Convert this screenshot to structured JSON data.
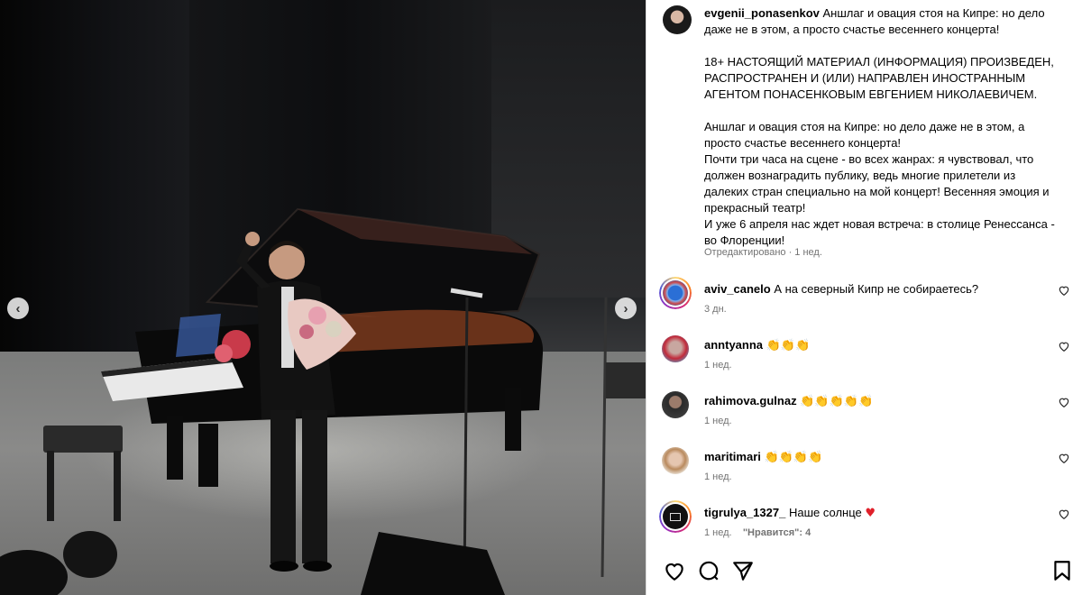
{
  "post": {
    "author": "evgenii_ponasenkov",
    "caption_first": "Аншлаг и овация стоя на Кипре: но дело даже не в этом, а просто счастье весеннего концерта!",
    "caption_body": "18+ НАСТОЯЩИЙ МАТЕРИАЛ (ИНФОРМАЦИЯ) ПРОИЗВЕДЕН, РАСПРОСТРАНЕН И (ИЛИ) НАПРАВЛЕН ИНОСТРАННЫМ АГЕНТОМ ПОНАСЕНКОВЫМ ЕВГЕНИЕМ НИКОЛАЕВИЧЕМ.\n\nАншлаг и овация стоя на Кипре: но дело даже не в этом, а просто счастье весеннего концерта!\nПочти три часа на сцене - во всех жанрах: я чувствовал, что должен вознаградить публику, ведь многие прилетели из далеких стран специально на мой концерт! Весенняя эмоция и прекрасный театр!\nИ уже 6 апреля нас ждет новая встреча: в столице Ренессанса - во Флоренции!",
    "meta": "Отредактировано · 1 нед."
  },
  "comments": [
    {
      "user": "aviv_canelo",
      "text": "А на северный Кипр не собираетесь?",
      "time": "3 дн.",
      "likes": ""
    },
    {
      "user": "anntyanna",
      "text": "👏👏👏",
      "time": "1 нед.",
      "likes": ""
    },
    {
      "user": "rahimova.gulnaz",
      "text": "👏👏👏👏👏",
      "time": "1 нед.",
      "likes": ""
    },
    {
      "user": "maritimari",
      "text": "👏👏👏👏",
      "time": "1 нед.",
      "likes": ""
    },
    {
      "user": "tigrulya_1327_",
      "text": "Наше солнце",
      "time": "1 нед.",
      "likes": "\"Нравится\": 4"
    }
  ],
  "icons": {
    "like": "heart-icon",
    "comment": "comment-icon",
    "share": "share-icon",
    "save": "bookmark-icon",
    "prev": "chevron-left-icon",
    "next": "chevron-right-icon"
  },
  "nav": {
    "prev": "‹",
    "next": "›"
  },
  "colors": {
    "heart_red": "#ed4956",
    "meta_gray": "#737373",
    "border": "#dbdbdb"
  }
}
